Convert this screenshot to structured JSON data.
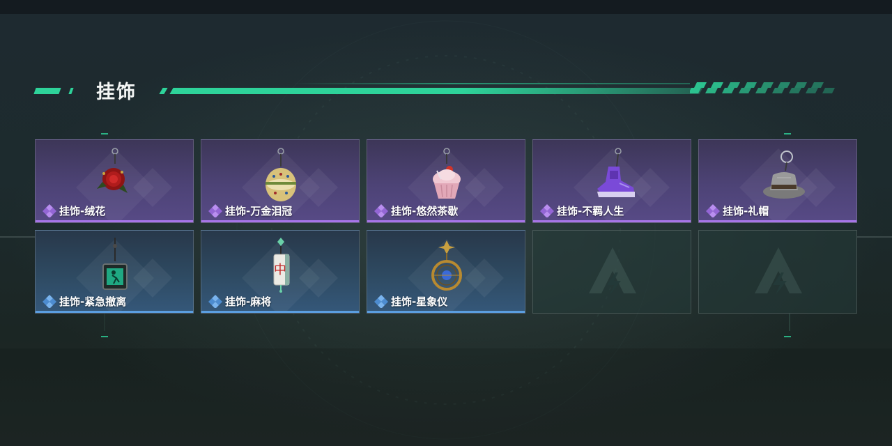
{
  "section": {
    "title": "挂饰"
  },
  "items": [
    {
      "name": "挂饰-绒花",
      "rarity": "purple",
      "icon": "rose-charm-icon"
    },
    {
      "name": "挂饰-万金泪冠",
      "rarity": "purple",
      "icon": "jeweled-egg-charm-icon"
    },
    {
      "name": "挂饰-悠然茶歇",
      "rarity": "purple",
      "icon": "cupcake-charm-icon"
    },
    {
      "name": "挂饰-不羁人生",
      "rarity": "purple",
      "icon": "sneaker-charm-icon"
    },
    {
      "name": "挂饰-礼帽",
      "rarity": "purple",
      "icon": "fedora-charm-icon"
    },
    {
      "name": "挂饰-紧急撤离",
      "rarity": "blue",
      "icon": "exit-sign-charm-icon"
    },
    {
      "name": "挂饰-麻将",
      "rarity": "blue",
      "icon": "mahjong-tile-charm-icon"
    },
    {
      "name": "挂饰-星象仪",
      "rarity": "blue",
      "icon": "astrolabe-charm-icon"
    },
    {
      "name": "",
      "rarity": "empty",
      "icon": "game-logo-icon"
    },
    {
      "name": "",
      "rarity": "empty",
      "icon": "game-logo-icon"
    }
  ],
  "colors": {
    "accent": "#2ed39a",
    "purple_rarity": "#a775e8",
    "blue_rarity": "#5b9ee0"
  }
}
